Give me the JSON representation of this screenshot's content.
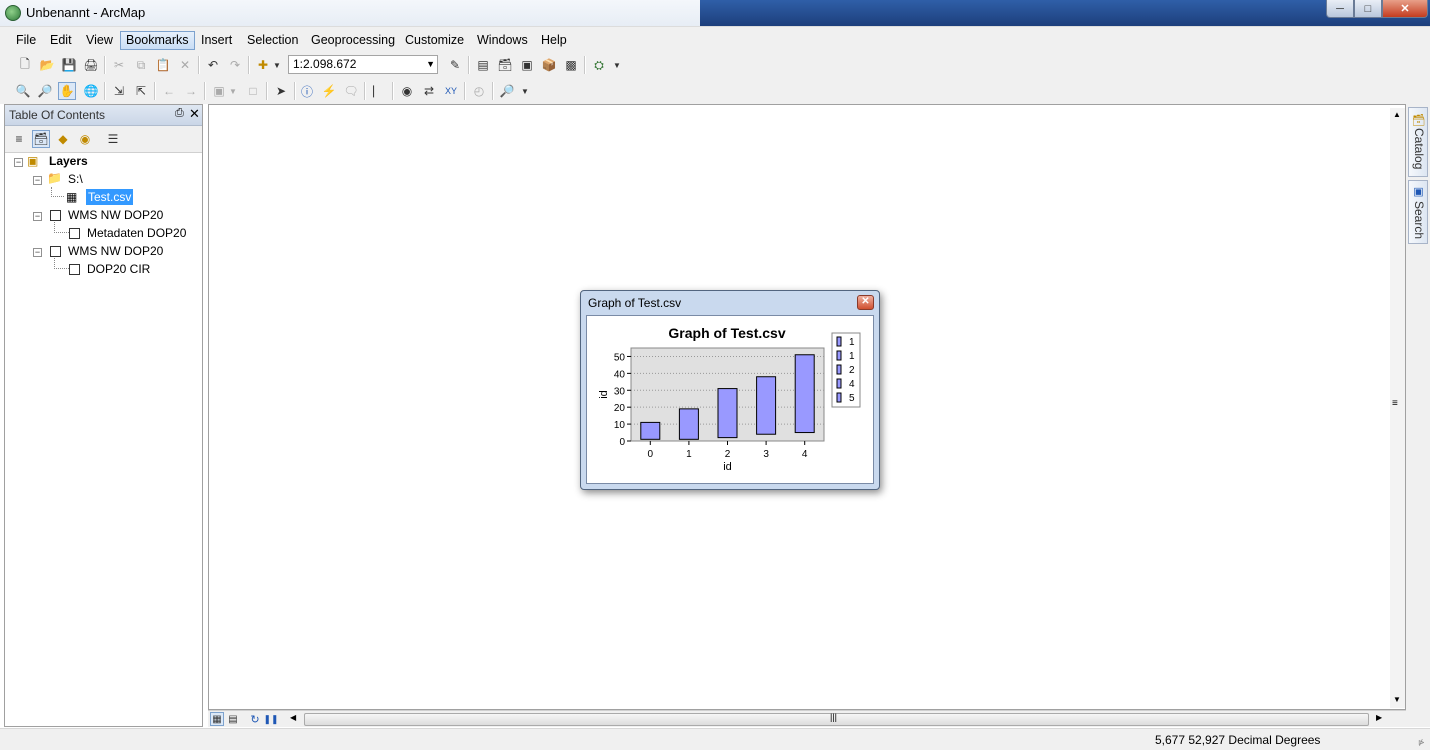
{
  "window": {
    "title": "Unbenannt - ArcMap"
  },
  "menu": [
    "File",
    "Edit",
    "View",
    "Bookmarks",
    "Insert",
    "Selection",
    "Geoprocessing",
    "Customize",
    "Windows",
    "Help"
  ],
  "toolbar": {
    "scale": "1:2.098.672"
  },
  "toc": {
    "title": "Table Of Contents",
    "layers_label": "Layers",
    "folder_label": "S:\\",
    "table_label": "Test.csv",
    "wms1_label": "WMS NW DOP20",
    "wms1_child": "Metadaten DOP20",
    "wms2_label": "WMS NW DOP20",
    "wms2_child": "DOP20 CIR"
  },
  "dock": {
    "catalog": "Catalog",
    "search": "Search"
  },
  "status": {
    "coords": "5,677  52,927 Decimal Degrees"
  },
  "dialog": {
    "title": "Graph of Test.csv"
  },
  "chart_data": {
    "type": "bar",
    "title": "Graph of Test.csv",
    "xlabel": "id",
    "ylabel": "id",
    "categories": [
      "0",
      "1",
      "2",
      "3",
      "4"
    ],
    "series": [
      {
        "values": [
          11,
          19,
          31,
          38,
          51
        ]
      }
    ],
    "bar_bottoms": [
      1,
      1,
      2,
      4,
      5
    ],
    "ylim": [
      0,
      55
    ],
    "yticks": [
      "0",
      "10",
      "20",
      "30",
      "40",
      "50"
    ],
    "legend": [
      "1",
      "1",
      "2",
      "4",
      "5"
    ],
    "legend_position": "right",
    "grid": true,
    "bar_color": "#9999ff"
  }
}
